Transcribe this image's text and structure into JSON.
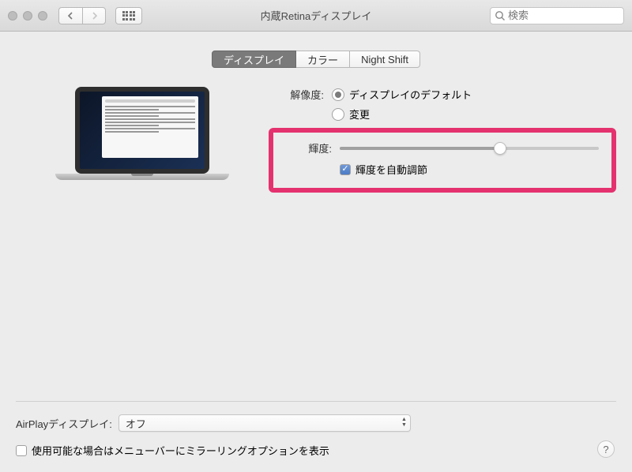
{
  "window": {
    "title": "内蔵Retinaディスプレイ",
    "search_placeholder": "検索"
  },
  "tabs": {
    "display": "ディスプレイ",
    "color": "カラー",
    "night_shift": "Night Shift",
    "active": "display"
  },
  "resolution": {
    "label": "解像度:",
    "option_default": "ディスプレイのデフォルト",
    "option_scaled": "変更",
    "selected": "default"
  },
  "brightness": {
    "label": "輝度:",
    "value_percent": 62,
    "auto_label": "輝度を自動調節",
    "auto_checked": true
  },
  "airplay": {
    "label": "AirPlayディスプレイ:",
    "value": "オフ"
  },
  "mirroring": {
    "label": "使用可能な場合はメニューバーにミラーリングオプションを表示",
    "checked": false
  },
  "help": "?"
}
